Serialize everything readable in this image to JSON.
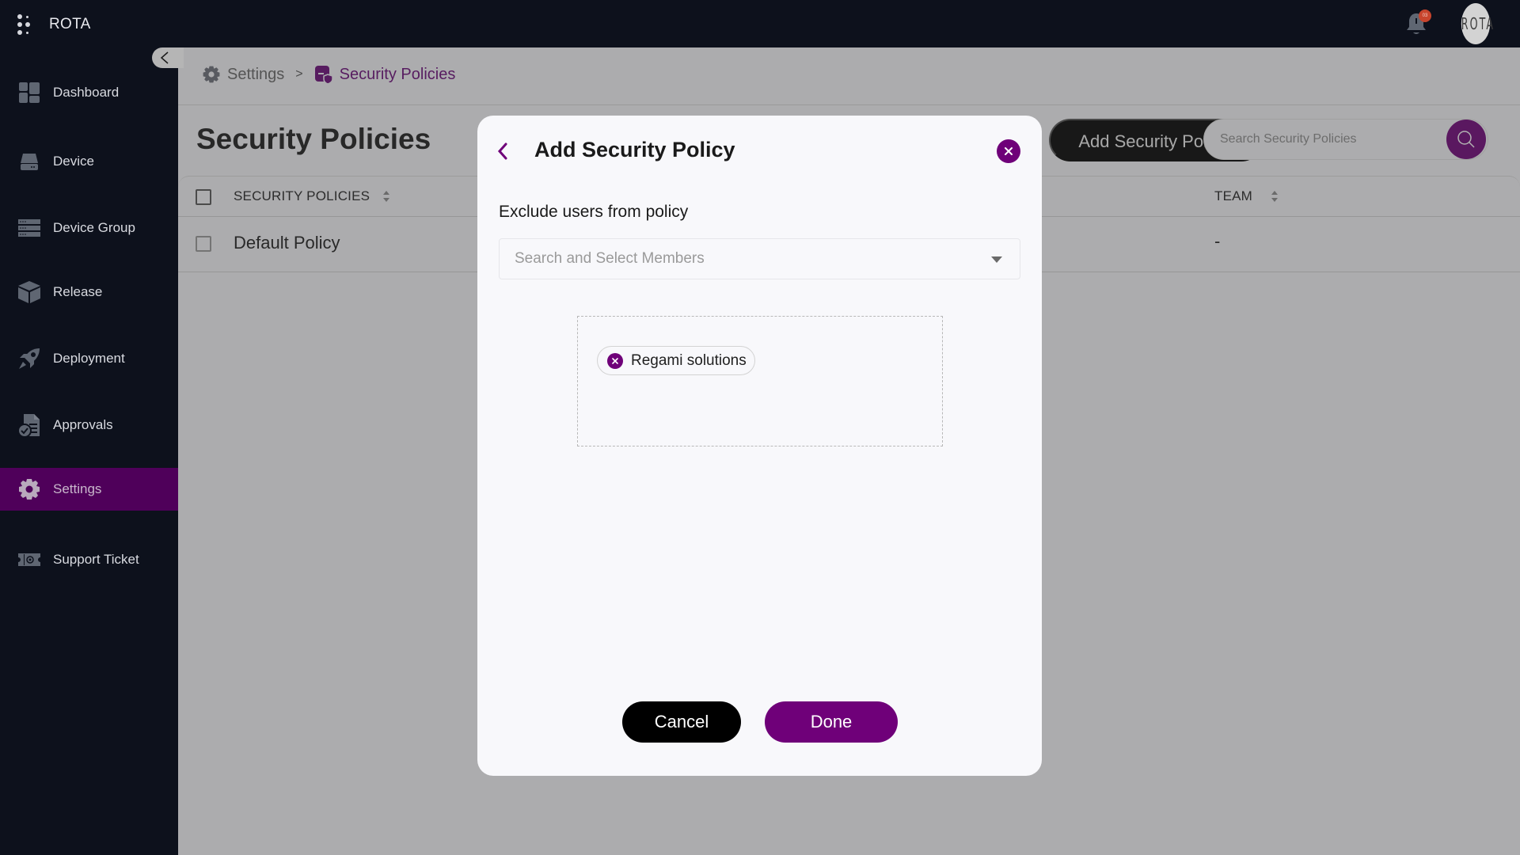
{
  "app": {
    "name": "ROTA",
    "notification_count": "03",
    "avatar_text": "ROTA"
  },
  "colors": {
    "brand_purple": "#6f0079",
    "sidebar_bg": "#0d111c",
    "sidebar_active": "#4f005a",
    "badge_red": "#c8452d"
  },
  "sidebar": {
    "items": [
      {
        "label": "Dashboard",
        "icon": "dashboard-icon"
      },
      {
        "label": "Device",
        "icon": "device-icon"
      },
      {
        "label": "Device Group",
        "icon": "device-group-icon"
      },
      {
        "label": "Release",
        "icon": "release-box-icon"
      },
      {
        "label": "Deployment",
        "icon": "rocket-icon"
      },
      {
        "label": "Approvals",
        "icon": "approvals-document-icon"
      },
      {
        "label": "Settings",
        "icon": "gear-icon",
        "active": true
      },
      {
        "label": "Support Ticket",
        "icon": "ticket-icon"
      }
    ]
  },
  "breadcrumb": {
    "items": [
      {
        "label": "Settings",
        "icon": "gear-icon"
      },
      {
        "label": "Security Policies",
        "icon": "security-policy-icon"
      }
    ],
    "separator": ">"
  },
  "page": {
    "title": "Security Policies",
    "add_button_label": "Add Security Policies",
    "search_placeholder": "Search Security Policies"
  },
  "table": {
    "columns": [
      {
        "label": "SECURITY POLICIES",
        "sortable": true
      },
      {
        "label": "TEAM",
        "sortable": true
      }
    ],
    "rows": [
      {
        "policy": "Default Policy",
        "team": "-"
      }
    ]
  },
  "modal": {
    "title": "Add Security Policy",
    "field_label": "Exclude users from policy",
    "select_placeholder": "Search and Select Members",
    "selected_members": [
      "Regami solutions"
    ],
    "cancel_label": "Cancel",
    "done_label": "Done"
  }
}
